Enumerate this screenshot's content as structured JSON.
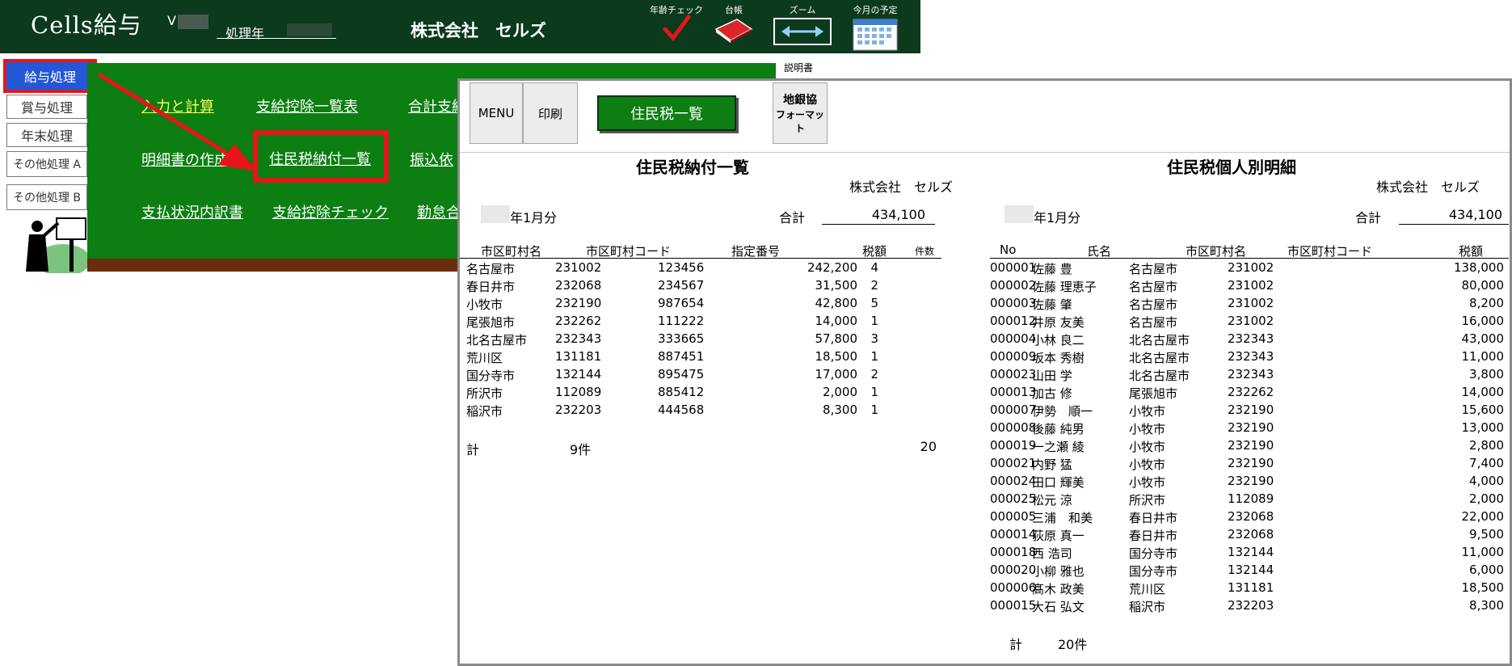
{
  "header": {
    "app_title": "Cells給与",
    "version_prefix": "V",
    "year_label": "処理年",
    "company": "株式会社　セルズ",
    "tools": {
      "age_check": "年齢チェック",
      "ledger": "台帳",
      "zoom": "ズーム",
      "schedule": "今月の予定"
    }
  },
  "sidebar": {
    "items": [
      "給与処理",
      "賞与処理",
      "年末処理",
      "その他処理 A",
      "その他処理 B"
    ]
  },
  "menu": {
    "links": [
      "入力と計算",
      "支給控除一覧表",
      "合計支給",
      "明細書の作成",
      "住民税納付一覧",
      "振込依",
      "支払状況内訳書",
      "支給控除チェック",
      "勤怠合"
    ]
  },
  "dialog": {
    "doc_label": "説明書",
    "buttons": {
      "menu": "MENU",
      "print": "印刷",
      "title": "住民税一覧",
      "bank_line1": "地銀協",
      "bank_line2": "フォーマット"
    },
    "left": {
      "title": "住民税納付一覧",
      "company": "株式会社　セルズ",
      "period": "年1月分",
      "total_label": "合計",
      "total_value": "434,100",
      "headers": [
        "市区町村名",
        "市区町村コード",
        "指定番号",
        "税額",
        "件数"
      ],
      "rows": [
        [
          "名古屋市",
          "231002",
          "123456",
          "242,200",
          "4"
        ],
        [
          "春日井市",
          "232068",
          "234567",
          "31,500",
          "2"
        ],
        [
          "小牧市",
          "232190",
          "987654",
          "42,800",
          "5"
        ],
        [
          "尾張旭市",
          "232262",
          "111222",
          "14,000",
          "1"
        ],
        [
          "北名古屋市",
          "232343",
          "333665",
          "57,800",
          "3"
        ],
        [
          "荒川区",
          "131181",
          "887451",
          "18,500",
          "1"
        ],
        [
          "国分寺市",
          "132144",
          "895475",
          "17,000",
          "2"
        ],
        [
          "所沢市",
          "112089",
          "885412",
          "2,000",
          "1"
        ],
        [
          "稲沢市",
          "232203",
          "444568",
          "8,300",
          "1"
        ]
      ],
      "footer_label": "計",
      "footer_count": "9件",
      "footer_total": "20"
    },
    "right": {
      "title": "住民税個人別明細",
      "company": "株式会社　セルズ",
      "period": "年1月分",
      "total_label": "合計",
      "total_value": "434,100",
      "headers": [
        "No",
        "氏名",
        "市区町村名",
        "市区町村コード",
        "税額"
      ],
      "rows": [
        [
          "000001",
          "佐藤 豊",
          "名古屋市",
          "231002",
          "138,000"
        ],
        [
          "000002",
          "佐藤 理恵子",
          "名古屋市",
          "231002",
          "80,000"
        ],
        [
          "000003",
          "佐藤 肇",
          "名古屋市",
          "231002",
          "8,200"
        ],
        [
          "000012",
          "井原 友美",
          "名古屋市",
          "231002",
          "16,000"
        ],
        [
          "000004",
          "小林 良二",
          "北名古屋市",
          "232343",
          "43,000"
        ],
        [
          "000009",
          "坂本 秀樹",
          "北名古屋市",
          "232343",
          "11,000"
        ],
        [
          "000023",
          "山田 学",
          "北名古屋市",
          "232343",
          "3,800"
        ],
        [
          "000013",
          "加古 修",
          "尾張旭市",
          "232262",
          "14,000"
        ],
        [
          "000007",
          "伊勢　順一",
          "小牧市",
          "232190",
          "15,600"
        ],
        [
          "000008",
          "後藤 純男",
          "小牧市",
          "232190",
          "13,000"
        ],
        [
          "000019",
          "一之瀬 綾",
          "小牧市",
          "232190",
          "2,800"
        ],
        [
          "000021",
          "内野 猛",
          "小牧市",
          "232190",
          "7,400"
        ],
        [
          "000024",
          "田口 輝美",
          "小牧市",
          "232190",
          "4,000"
        ],
        [
          "000025",
          "松元 涼",
          "所沢市",
          "112089",
          "2,000"
        ],
        [
          "000005",
          "三浦　和美",
          "春日井市",
          "232068",
          "22,000"
        ],
        [
          "000014",
          "荻原 真一",
          "春日井市",
          "232068",
          "9,500"
        ],
        [
          "000018",
          "西 浩司",
          "国分寺市",
          "132144",
          "11,000"
        ],
        [
          "000020",
          "小柳 雅也",
          "国分寺市",
          "132144",
          "6,000"
        ],
        [
          "000006",
          "髙木 政美",
          "荒川区",
          "131181",
          "18,500"
        ],
        [
          "000015",
          "大石 弘文",
          "稲沢市",
          "232203",
          "8,300"
        ]
      ],
      "footer_label": "計",
      "footer_count": "20件"
    }
  },
  "colors": {
    "header_bg": "#0b3a1d",
    "menu_green": "#0c7e12",
    "highlight_red": "#e8141a",
    "active_blue": "#2357d6"
  }
}
